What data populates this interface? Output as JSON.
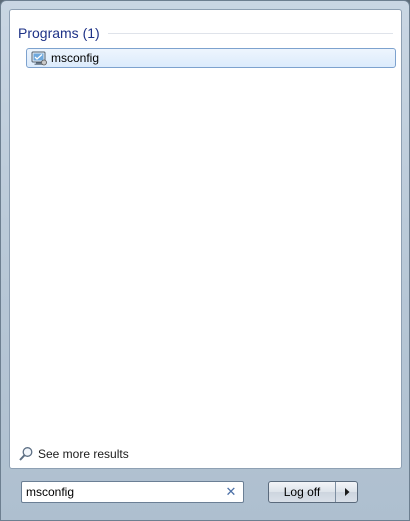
{
  "results": {
    "group_title": "Programs (1)",
    "items": [
      {
        "label": "msconfig",
        "icon": "msconfig-app-icon"
      }
    ]
  },
  "see_more": {
    "label": "See more results",
    "icon": "magnifier-icon"
  },
  "search": {
    "value": "msconfig",
    "clear_icon": "clear-icon"
  },
  "power": {
    "label": "Log off",
    "arrow_icon": "right-arrow-icon"
  }
}
